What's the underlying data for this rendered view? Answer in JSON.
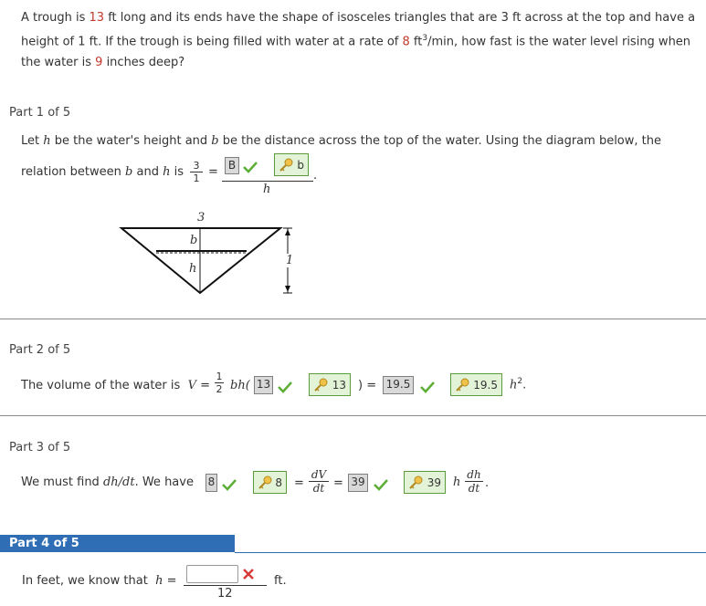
{
  "problem": {
    "t1": "A trough is ",
    "length": "13",
    "t2": " ft long and its ends have the shape of isosceles triangles that are 3 ft across at the top and have a height of 1 ft. If the trough is being filled with water at a rate of ",
    "rate": "8",
    "t3": " ft",
    "sup": "3",
    "t4": "/min, how fast is the water level rising when the water is ",
    "depth": "9",
    "t5": " inches deep?"
  },
  "part1": {
    "header": "Part 1 of 5",
    "line1_a": "Let ",
    "h": "h",
    "line1_b": " be the water's height and ",
    "b": "b",
    "line1_c": " be the distance across the top of the water. Using the diagram below, the",
    "line2_a": "relation between ",
    "line2_b": " and ",
    "line2_c": " is",
    "frac_num": "3",
    "frac_den": "1",
    "eq": "=",
    "ans_entered": "B",
    "ans_key": "b",
    "denominator": "h",
    "period": ".",
    "diagram": {
      "top_label": "3",
      "b_label": "b",
      "h_label": "h",
      "side_label": "1"
    }
  },
  "part2": {
    "header": "Part 2 of 5",
    "text": "The volume of the water is",
    "V": "V",
    "eq": "=",
    "half_num": "1",
    "half_den": "2",
    "bh": "bh(",
    "ans1_entered": "13",
    "ans1_key": "13",
    "close": ") =",
    "ans2_entered": "19.5",
    "ans2_key": "19.5",
    "h2": "h",
    "sup": "2",
    "period": "."
  },
  "part3": {
    "header": "Part 3 of 5",
    "text_a": "We must find ",
    "dhdt": "dh/dt",
    "text_b": ". We have",
    "ans1_entered": "8",
    "ans1_key": "8",
    "eq1": "=",
    "dV": "dV",
    "dt": "dt",
    "eq2": "=",
    "ans2_entered": "39",
    "ans2_key": "39",
    "h": "h",
    "dh": "dh",
    "dt2": "dt",
    "period": "."
  },
  "part4": {
    "header": "Part 4 of 5",
    "text": "In feet, we know that",
    "h": "h",
    "eq": "=",
    "denominator": "12",
    "unit": "ft."
  },
  "colors": {
    "accent": "#2f6db5",
    "highlight": "#c0392b",
    "correct": "#5cae36",
    "wrong": "#d93a3a"
  }
}
